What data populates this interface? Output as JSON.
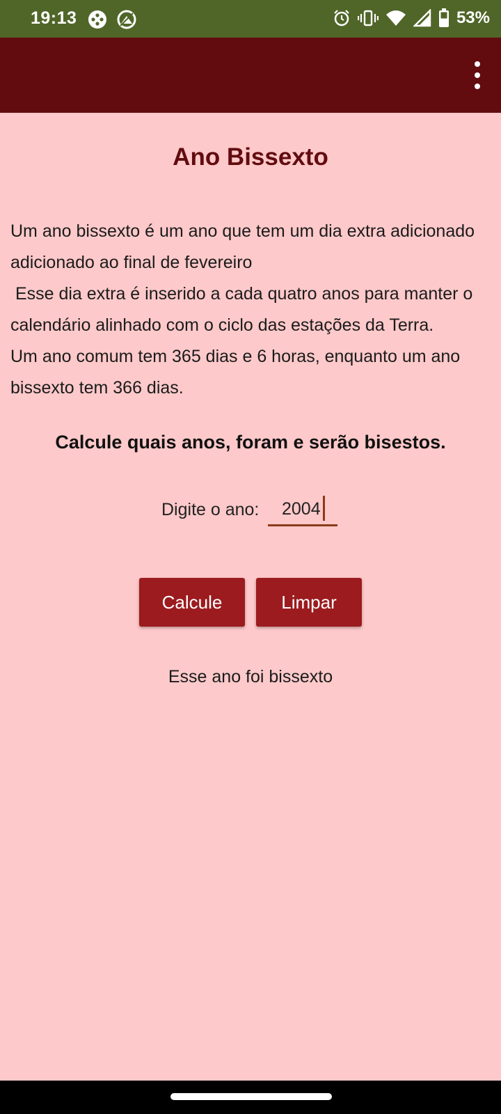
{
  "status_bar": {
    "time": "19:13",
    "battery_pct": "53%",
    "icons": [
      "gamepad-icon",
      "no-entry-icon",
      "alarm-icon",
      "vibrate-icon",
      "wifi-icon",
      "signal-icon",
      "battery-icon"
    ]
  },
  "app_bar": {
    "overflow_icon": "more-vert-icon",
    "color": "#620c10"
  },
  "main": {
    "title": "Ano Bissexto",
    "description_lines": [
      "Um ano bissexto é um ano que tem um dia extra adicionado",
      "adicionado ao final de fevereiro",
      " Esse dia extra é inserido a cada quatro anos para manter o",
      "calendário alinhado com o ciclo das estações da Terra.",
      "Um ano comum tem 365 dias e 6 horas, enquanto um ano",
      "bissexto tem 366 dias."
    ],
    "subtitle": "Calcule quais anos, foram e serão bisestos.",
    "input_label": "Digite o ano:",
    "input_value": "2004",
    "calc_button": "Calcule",
    "clear_button": "Limpar",
    "result": "Esse ano foi bissexto"
  },
  "colors": {
    "status_bar": "#506628",
    "background": "#fec9ca",
    "button": "#9b1b1f",
    "title": "#620c10"
  }
}
